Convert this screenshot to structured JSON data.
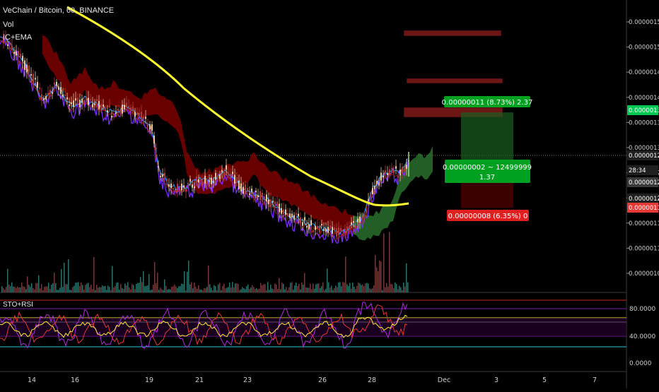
{
  "header": {
    "symbol_line": "VeChain / Bitcoin, 60, BINANCE",
    "indicator_1": "Vol",
    "indicator_2": "IC+EMA"
  },
  "price_axis": {
    "ticks": [
      "0.00000155",
      "0.00000150",
      "0.00000145",
      "0.00000140",
      "0.00000135",
      "0.00000130",
      "0.00000125",
      "0.00000120",
      "0.00000115",
      "0.00000110",
      "0.00000105"
    ],
    "badges": [
      {
        "label": "0.00000137",
        "color": "#00c853"
      },
      {
        "label": "0.00000128",
        "color": "#1f1f1f"
      },
      {
        "label": "28:34",
        "color": "#1f1f1f"
      },
      {
        "label": "0.00000126",
        "color": "#3a3a3a"
      },
      {
        "label": "0.00000120",
        "color": "#1f1f1f"
      },
      {
        "label": "0.00000118",
        "color": "#e53935"
      }
    ]
  },
  "position_tool": {
    "target_label": "0.00000011 (8.73%) 2.37",
    "middle_label_line1": "0.00000002 ~ 12499999",
    "middle_label_line2": "1.37",
    "stop_label": "0.00000008 (6.35%) 0"
  },
  "oscillator": {
    "title": "STO+RSI",
    "ticks": [
      "80.0000",
      "40.0000",
      "0.0000"
    ]
  },
  "time_axis": {
    "labels": [
      "14",
      "16",
      "19",
      "21",
      "23",
      "26",
      "28",
      "Dec",
      "3",
      "5",
      "7"
    ]
  },
  "colors": {
    "ema": "#ffff2e",
    "price_line": "#7a2bff",
    "cloud_bear": "#8b0000",
    "cloud_bull": "#2e7d32",
    "resistance": "#c62828",
    "target_zone": "#1b5e20",
    "stop_zone": "#4a0000"
  },
  "chart_data": {
    "type": "line",
    "series": [
      {
        "name": "",
        "x": [
          "14",
          "16",
          "19",
          "21",
          "23",
          "26",
          "28"
        ],
        "values": [
          1.42e-06,
          1.4e-06,
          1.23e-06,
          1.22e-06,
          1.19e-06,
          1.13e-06,
          1.25e-06
        ]
      }
    ],
    "ylim": [
      1.02e-06,
      1.56e-06
    ],
    "target_price": 1.37e-06,
    "entry_price": 1.26e-06,
    "stop_price": 1.18e-06
  }
}
